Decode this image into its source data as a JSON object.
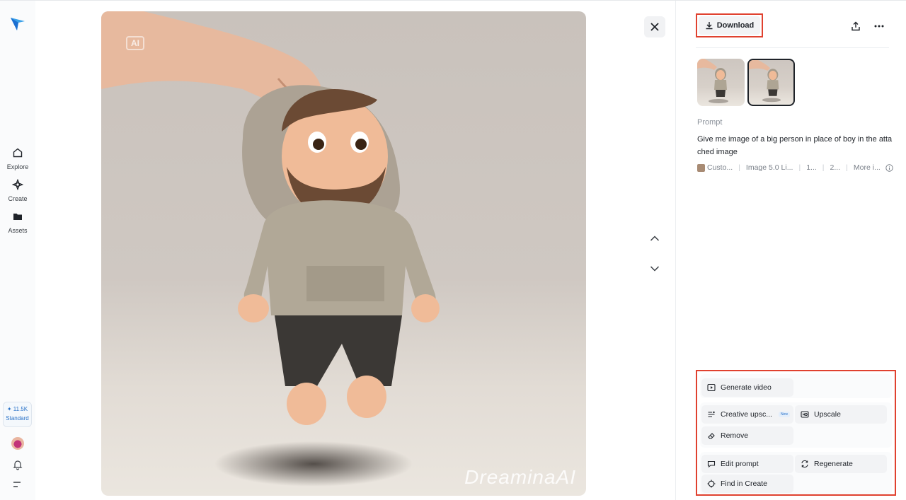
{
  "sidebar": {
    "nav": [
      {
        "label": "Explore",
        "icon": "home-icon"
      },
      {
        "label": "Create",
        "icon": "sparkle-icon"
      },
      {
        "label": "Assets",
        "icon": "folder-icon"
      }
    ],
    "credits": {
      "amount": "✦ 11.5K",
      "plan": "Standard"
    }
  },
  "image": {
    "alt_watermark": "DreaminaAI",
    "ai_badge": "AI"
  },
  "panel": {
    "download_label": "Download",
    "prompt_title": "Prompt",
    "prompt_text": "Give me image of a big person in place of boy in the attached image",
    "meta": [
      "Custo...",
      "Image 5.0 Li...",
      "1...",
      "2...",
      "More i..."
    ]
  },
  "tools": {
    "generate_video": "Generate video",
    "creative_upscale": "Creative upsc...",
    "new_badge": "New",
    "upscale": "Upscale",
    "remove": "Remove",
    "edit_prompt": "Edit prompt",
    "regenerate": "Regenerate",
    "find_in_create": "Find in Create"
  },
  "colors": {
    "accent_red": "#e0412f",
    "link_blue": "#2a72c8"
  }
}
